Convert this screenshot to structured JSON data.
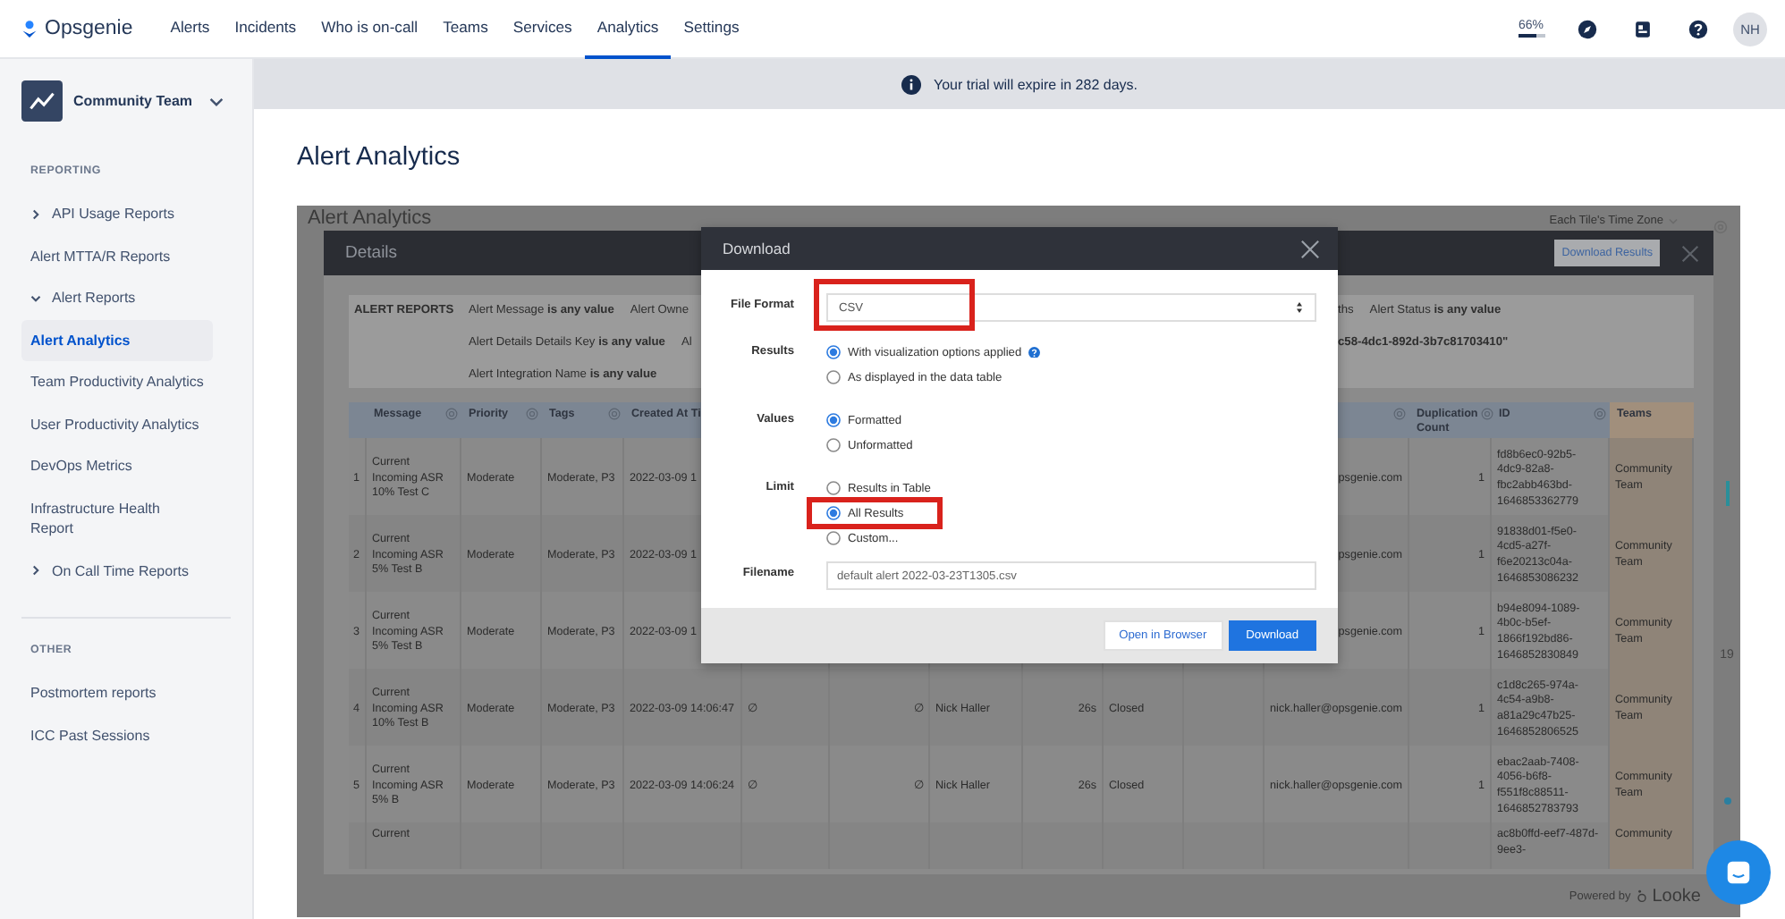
{
  "nav": {
    "logo": "Opsgenie",
    "items": [
      {
        "label": "Alerts",
        "selected": false
      },
      {
        "label": "Incidents",
        "selected": false
      },
      {
        "label": "Who is on-call",
        "selected": false
      },
      {
        "label": "Teams",
        "selected": false
      },
      {
        "label": "Services",
        "selected": false
      },
      {
        "label": "Analytics",
        "selected": true
      },
      {
        "label": "Settings",
        "selected": false
      }
    ],
    "usage": {
      "text": "66%",
      "level": 0.66
    },
    "avatar": "NH"
  },
  "sidebar": {
    "team": "Community Team",
    "sections": [
      {
        "heading": "REPORTING",
        "items": [
          {
            "label": "API Usage Reports",
            "kind": "group",
            "expanded": false,
            "selected": false
          },
          {
            "label": "Alert MTTA/R Reports",
            "kind": "link",
            "selected": false
          },
          {
            "label": "Alert Reports",
            "kind": "group",
            "expanded": true,
            "selected": false
          },
          {
            "label": "Alert Analytics",
            "kind": "link",
            "selected": true
          },
          {
            "label": "Team Productivity Analytics",
            "kind": "link",
            "selected": false
          },
          {
            "label": "User Productivity Analytics",
            "kind": "link",
            "selected": false
          },
          {
            "label": "DevOps Metrics",
            "kind": "link",
            "selected": false
          },
          {
            "label": "Infrastructure Health Report",
            "kind": "link",
            "selected": false
          },
          {
            "label": "On Call Time Reports",
            "kind": "group",
            "expanded": false,
            "selected": false
          }
        ]
      },
      {
        "heading": "OTHER",
        "items": [
          {
            "label": "Postmortem reports",
            "kind": "link",
            "selected": false
          },
          {
            "label": "ICC Past Sessions",
            "kind": "link",
            "selected": false
          }
        ]
      }
    ]
  },
  "banner": "Your trial will expire in 282 days.",
  "page_title": "Alert Analytics",
  "dashboard": {
    "title": "Alert Analytics",
    "time_zone": "Each Tile's Time Zone",
    "side_value": "19",
    "details": {
      "title": "Details",
      "download_button": "Download Results",
      "filter_label": "ALERT REPORTS",
      "filter_lines": [
        {
          "left": [
            "Alert Message **is any value**",
            "Alert Owne"
          ],
          "right": [
            "ths",
            "Alert Status **is any value**"
          ]
        },
        {
          "left": [
            "Alert Details Details Key **is any value**",
            "Al"
          ],
          "right": [
            "**c58-4dc1-892d-3b7c81703410\"**"
          ]
        },
        {
          "left": [
            "Alert Integration Name **is any value**"
          ]
        }
      ],
      "columns": [
        {
          "label": "Message",
          "settings_icon": true
        },
        {
          "label": "Priority",
          "settings_icon": true
        },
        {
          "label": "Tags",
          "settings_icon": true
        },
        {
          "label": "Created At Ti"
        },
        {},
        {},
        {},
        {},
        {},
        {},
        {
          "settings_icon": true
        },
        {
          "label": "Duplication Count",
          "settings_icon": true
        },
        {
          "label": "ID",
          "settings_icon": true
        },
        {
          "label": "Teams",
          "settings_icon": false
        }
      ],
      "rows": [
        {
          "number": "1",
          "cells": [
            "Current Incoming ASR 10% Test C",
            "Moderate",
            "Moderate, P3",
            "2022-03-09 1",
            null,
            null,
            null,
            null,
            null,
            null,
            "psgenie.com",
            "1",
            "fd8b6ec0-92b5-4dc9-82a8-fbc2abb463bd-1646853362779",
            "Community Team"
          ]
        },
        {
          "number": "2",
          "cells": [
            "Current Incoming ASR 5% Test B",
            "Moderate",
            "Moderate, P3",
            "2022-03-09 1",
            null,
            null,
            null,
            null,
            null,
            null,
            "psgenie.com",
            "1",
            "91838d01-f5e0-4cd5-a27f-f6e20213c04a-1646853086232",
            "Community Team"
          ]
        },
        {
          "number": "3",
          "cells": [
            "Current Incoming ASR 5% Test B",
            "Moderate",
            "Moderate, P3",
            "2022-03-09 1",
            null,
            null,
            null,
            null,
            null,
            null,
            "psgenie.com",
            "1",
            "b94e8094-1089-4b0c-b5ef-1866f192bd86-1646852830849",
            "Community Team"
          ]
        },
        {
          "number": "4",
          "cells": [
            "Current Incoming ASR 10% Test B",
            "Moderate",
            "Moderate, P3",
            "2022-03-09 14:06:47",
            "∅",
            "∅",
            "Nick Haller",
            "26s",
            "Closed",
            null,
            "nick.haller@opsgenie.com",
            "1",
            "c1d8c265-974a-4c54-a9b8-a81a29c47b25-1646852806525",
            "Community Team"
          ]
        },
        {
          "number": "5",
          "cells": [
            "Current Incoming ASR 5% B",
            "Moderate",
            "Moderate, P3",
            "2022-03-09 14:06:24",
            "∅",
            "∅",
            "Nick Haller",
            "26s",
            "Closed",
            null,
            "nick.haller@opsgenie.com",
            "1",
            "ebac2aab-7408-4056-b6f8-f551f8c88511-1646852783793",
            "Community Team"
          ]
        },
        {
          "cells": [
            "Current",
            null,
            null,
            null,
            null,
            null,
            null,
            null,
            null,
            null,
            null,
            null,
            "ac8b0ffd-eef7-487d-9ee3-",
            "Community"
          ]
        }
      ]
    },
    "powered_by": "Powered by",
    "brand": "Looke"
  },
  "download_dialog": {
    "title": "Download",
    "file_format": {
      "label": "File Format",
      "value": "CSV",
      "highlighted": true
    },
    "groups": [
      {
        "label": "Results",
        "options": [
          {
            "label": "With visualization options applied",
            "selected": true,
            "help": true,
            "highlighted": false
          },
          {
            "label": "As displayed in the data table",
            "selected": false,
            "help": false,
            "highlighted": false
          }
        ]
      },
      {
        "label": "Values",
        "options": [
          {
            "label": "Formatted",
            "selected": true,
            "help": false,
            "highlighted": false
          },
          {
            "label": "Unformatted",
            "selected": false,
            "help": false,
            "highlighted": false
          }
        ]
      },
      {
        "label": "Limit",
        "options": [
          {
            "label": "Results in Table",
            "selected": false,
            "help": false,
            "highlighted": false
          },
          {
            "label": "All Results",
            "selected": true,
            "help": false,
            "highlighted": true
          },
          {
            "label": "Custom...",
            "selected": false,
            "help": false,
            "highlighted": false
          }
        ]
      }
    ],
    "filename": {
      "label": "Filename",
      "value": "default alert 2022-03-23T1305.csv"
    },
    "buttons": [
      {
        "label": "Open in Browser",
        "kind": "secondary"
      },
      {
        "label": "Download",
        "kind": "primary"
      }
    ]
  }
}
